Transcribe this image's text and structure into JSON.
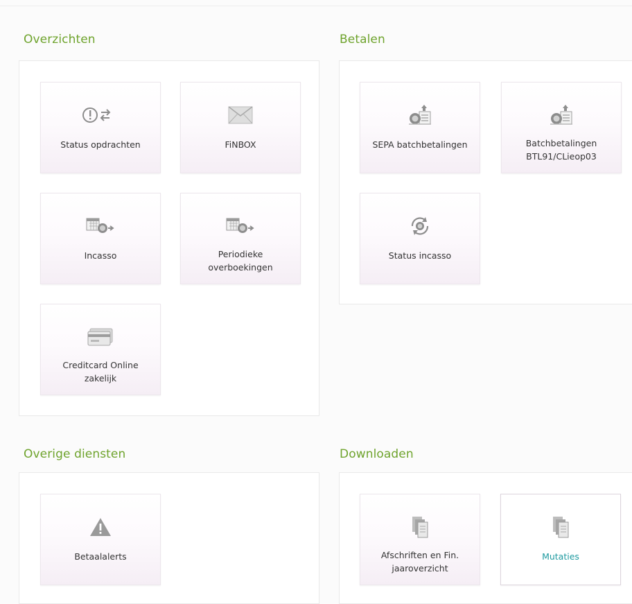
{
  "sections": {
    "overzichten": {
      "title": "Overzichten",
      "tiles": [
        {
          "label": "Status opdrachten",
          "icon": "status-exclaim-arrows-icon"
        },
        {
          "label": "FiNBOX",
          "icon": "envelope-icon"
        },
        {
          "label": "Incasso",
          "icon": "calendar-coin-arrow-icon"
        },
        {
          "label_line1": "Periodieke",
          "label_line2": "overboekingen",
          "icon": "calendar-coin-arrow-icon"
        },
        {
          "label_line1": "Creditcard Online",
          "label_line2": "zakelijk",
          "icon": "credit-card-icon"
        }
      ]
    },
    "betalen": {
      "title": "Betalen",
      "tiles": [
        {
          "label": "SEPA batchbetalingen",
          "icon": "coin-document-upload-icon"
        },
        {
          "label_line1": "Batchbetalingen",
          "label_line2": "BTL91/CLieop03",
          "icon": "coin-document-upload-icon"
        },
        {
          "label": "Status incasso",
          "icon": "coin-cycle-icon"
        }
      ]
    },
    "overige": {
      "title": "Overige diensten",
      "tiles": [
        {
          "label": "Betaalalerts",
          "icon": "warning-triangle-icon"
        }
      ]
    },
    "downloaden": {
      "title": "Downloaden",
      "tiles": [
        {
          "label_line1": "Afschriften en Fin.",
          "label_line2": "jaaroverzicht",
          "icon": "documents-stack-icon"
        },
        {
          "label": "Mutaties",
          "icon": "documents-stack-icon",
          "selected": true
        }
      ]
    }
  },
  "colors": {
    "section_title": "#6ea32c",
    "selected_label": "#1e9aa0",
    "icon_gray": "#9a9a9a"
  }
}
